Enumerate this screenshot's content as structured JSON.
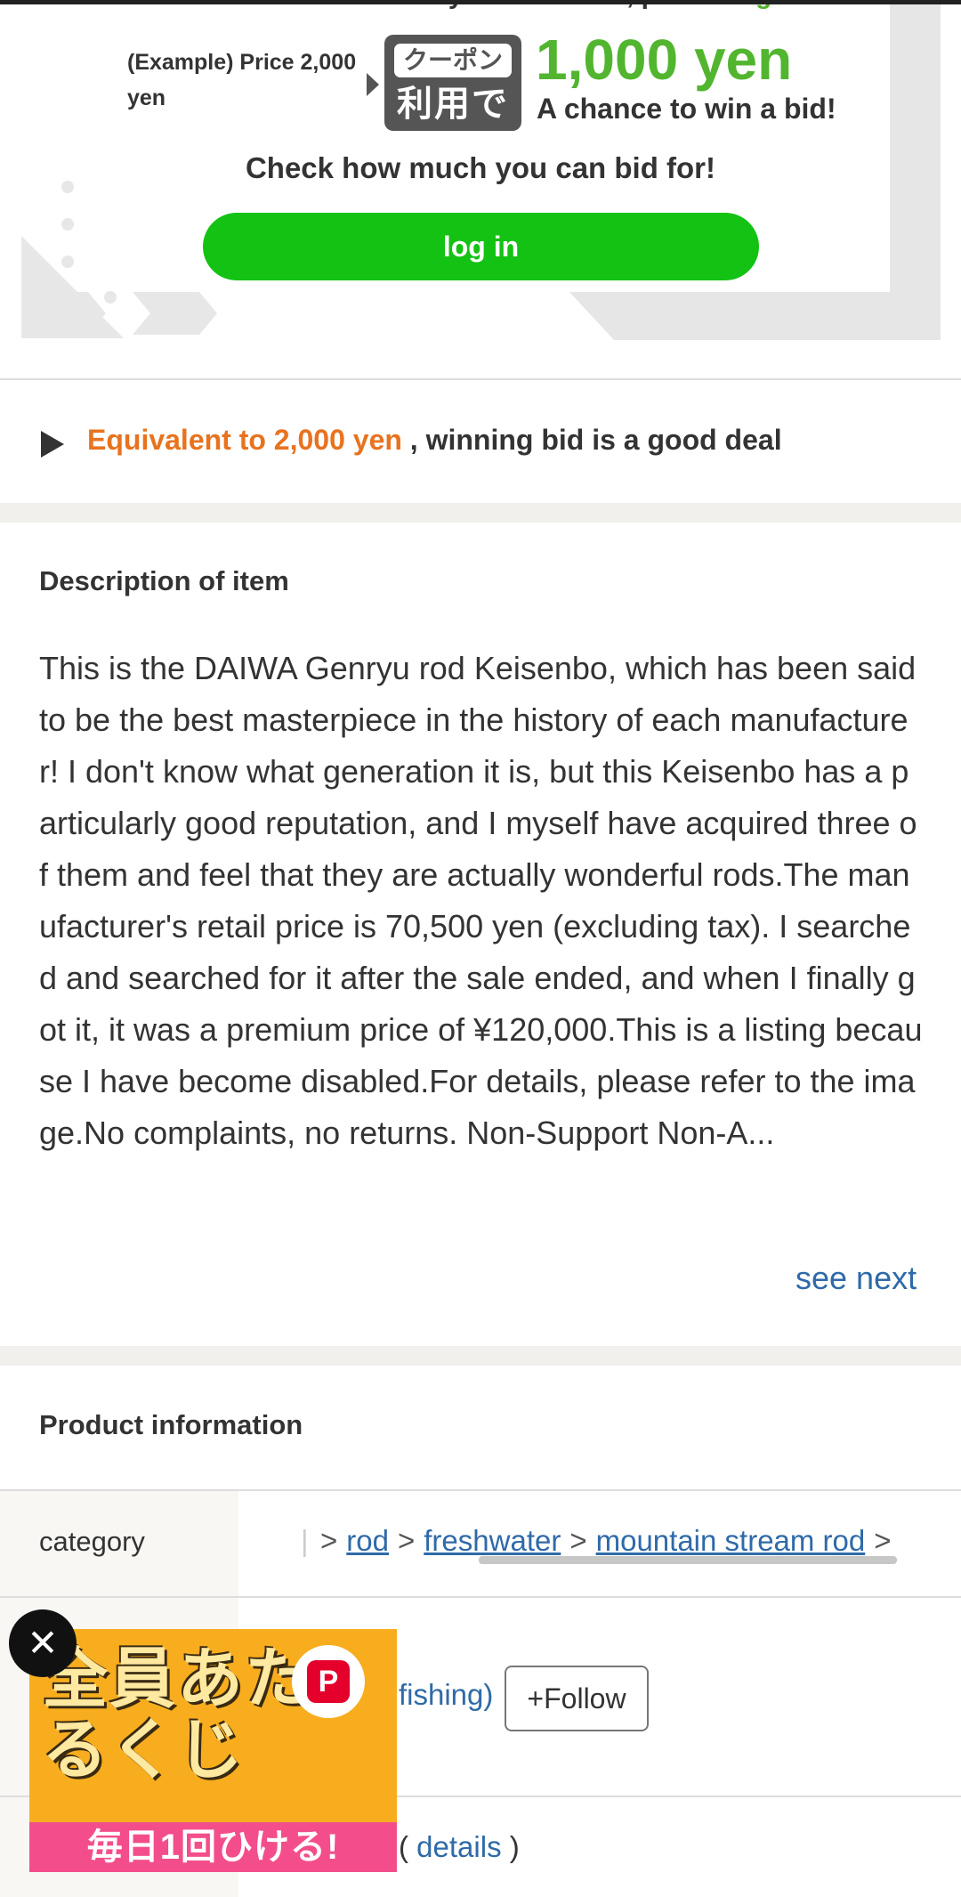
{
  "promo": {
    "top_text": "Yahoo! Auctions. If this is your first time, please ",
    "top_link": "log in >",
    "example_price": "(Example) Price 2,000 yen",
    "coupon_top": "クーポン",
    "coupon_bottom": "利用で",
    "yen_big": "1,000 yen",
    "bid_chance": "A chance to win a bid!",
    "check_bid": "Check how much you can bid for!",
    "login_button": "log in"
  },
  "deal": {
    "highlight": "Equivalent to 2,000 yen",
    "rest": " , winning bid is a good deal"
  },
  "description": {
    "heading": "Description of item",
    "body": "This is the DAIWA Genryu rod Keisenbo, which has been said to be the best masterpiece in the history of each manufacturer! I don't know what generation it is, but this Keisenbo has a particularly good reputation, and I myself have acquired three of them and feel that they are actually wonderful rods.The manufacturer's retail price is 70,500 yen (excluding tax). I searched and searched for it after the sale ended, and when I finally got it, it was a premium price of ¥120,000.This is a listing because I have become disabled.For details, please refer to the image.No complaints, no returns. Non-Support Non-A...",
    "see_next": "see next"
  },
  "product": {
    "heading": "Product information",
    "category_label": "category",
    "category_path": [
      "rod",
      "freshwater",
      "mountain stream rod"
    ],
    "seller_link_tail": "fishing)",
    "follow_button": "+Follow",
    "details_link": "details",
    "paren_open": "( ",
    "paren_close": " )"
  },
  "ad": {
    "title": "全員あたるくじ",
    "strip": "毎日1回ひける!",
    "logo": "P",
    "close": "✕"
  },
  "colors": {
    "green": "#13c213",
    "orange": "#e8731f",
    "link": "#2f6aa8"
  }
}
